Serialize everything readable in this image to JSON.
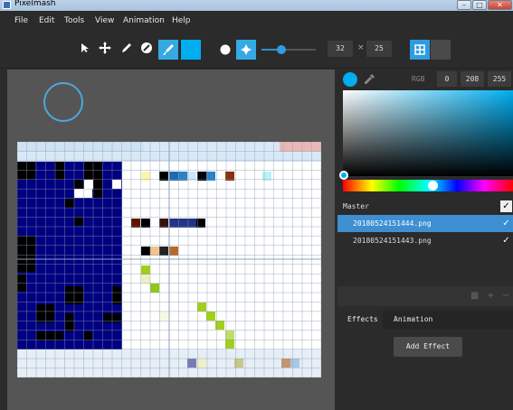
{
  "window": {
    "title": "Pixelmash",
    "buttons": [
      "–",
      "□",
      "✕"
    ]
  },
  "menu": [
    "File",
    "Edit",
    "Tools",
    "View",
    "Animation",
    "Help"
  ],
  "toolbar": {
    "tools": [
      "select-arrow-icon",
      "move-icon",
      "pen-icon",
      "eraser-icon",
      "brush-icon"
    ],
    "active_tool": "brush-icon",
    "brush_color": "#00aeef",
    "brush_shapes": [
      "round-brush-icon",
      "scatter-brush-icon"
    ],
    "brush_size_fraction": 0.43,
    "width_value": "32",
    "separator": "×",
    "height_value": "25"
  },
  "color_picker": {
    "rgb_label": "RGB",
    "r": "0",
    "g": "208",
    "b": "255",
    "current_color": "#00aeef"
  },
  "layers": [
    {
      "name": "Master",
      "visible": true,
      "selected": false
    },
    {
      "name": "20180524151444.png",
      "visible": true,
      "selected": true
    },
    {
      "name": "20180524151443.png",
      "visible": true,
      "selected": false
    }
  ],
  "tabs": [
    "Effects",
    "Animation"
  ],
  "effects": {
    "add_label": "Add Effect"
  },
  "colors": {
    "canvas_bg": "#555555",
    "panel_bg": "#2b2b2b",
    "accent": "#3d8fd1",
    "navy": "#000080"
  }
}
